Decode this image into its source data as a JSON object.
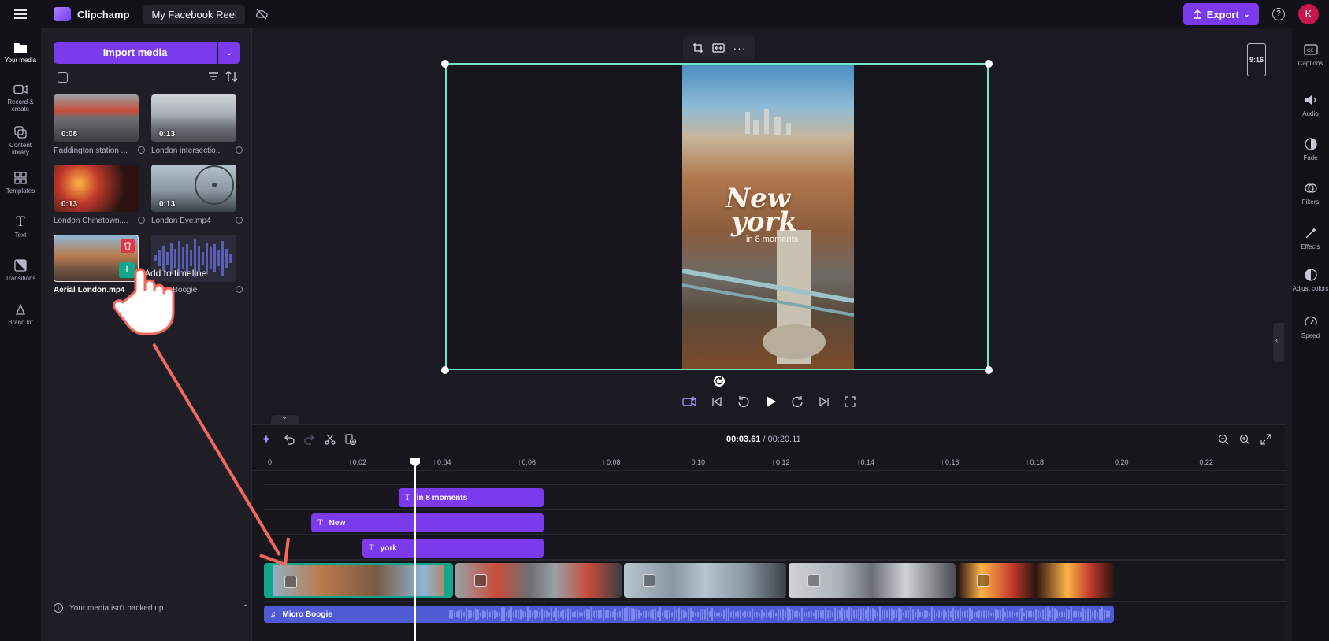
{
  "topbar": {
    "app_name": "Clipchamp",
    "project_title": "My Facebook Reel",
    "export_label": "Export",
    "help_label": "?",
    "avatar_initial": "K"
  },
  "leftnav": {
    "items": [
      {
        "label": "Your media",
        "icon": "folder-icon"
      },
      {
        "label": "Record & create",
        "icon": "camera-icon"
      },
      {
        "label": "Content library",
        "icon": "library-icon"
      },
      {
        "label": "Templates",
        "icon": "templates-icon"
      },
      {
        "label": "Text",
        "icon": "text-icon"
      },
      {
        "label": "Transitions",
        "icon": "transitions-icon"
      },
      {
        "label": "Brand kit",
        "icon": "brand-kit-icon"
      }
    ]
  },
  "media": {
    "import_label": "Import media",
    "items": [
      {
        "name": "Paddington station ...",
        "duration": "0:08"
      },
      {
        "name": "London intersectio...",
        "duration": "0:13"
      },
      {
        "name": "London Chinatown....",
        "duration": "0:13"
      },
      {
        "name": "London Eye.mp4",
        "duration": "0:13"
      },
      {
        "name": "Aerial London.mp4",
        "duration": ""
      },
      {
        "name": "Micro Boogie",
        "duration": ""
      }
    ],
    "add_to_timeline": "Add to timeline",
    "backup_notice": "Your media isn't backed up"
  },
  "preview": {
    "aspect_ratio": "9:16",
    "overlay_title_1": "New",
    "overlay_title_2": "york",
    "overlay_subtitle": "in 8 moments"
  },
  "rightpanel": {
    "items": [
      {
        "label": "Captions",
        "icon": "captions-icon"
      },
      {
        "label": "Audio",
        "icon": "speaker-icon"
      },
      {
        "label": "Fade",
        "icon": "fade-icon"
      },
      {
        "label": "Filters",
        "icon": "filters-icon"
      },
      {
        "label": "Effects",
        "icon": "effects-icon"
      },
      {
        "label": "Adjust colors",
        "icon": "adjust-colors-icon"
      },
      {
        "label": "Speed",
        "icon": "speed-icon"
      }
    ]
  },
  "timeline": {
    "current_time": "00:03.61",
    "total_time": "/ 00:20.11",
    "ticks": [
      "0",
      "0:02",
      "0:04",
      "0:06",
      "0:08",
      "0:10",
      "0:12",
      "0:14",
      "0:16",
      "0:18",
      "0:20",
      "0:22"
    ],
    "text_clips": [
      "in 8 moments",
      "New",
      "york"
    ],
    "audio_clip": "Micro Boogie"
  },
  "colors": {
    "accent": "#7c3aed",
    "selection": "#6ee7c8",
    "audio": "#4f5bd5",
    "arrow": "#f2685c"
  }
}
